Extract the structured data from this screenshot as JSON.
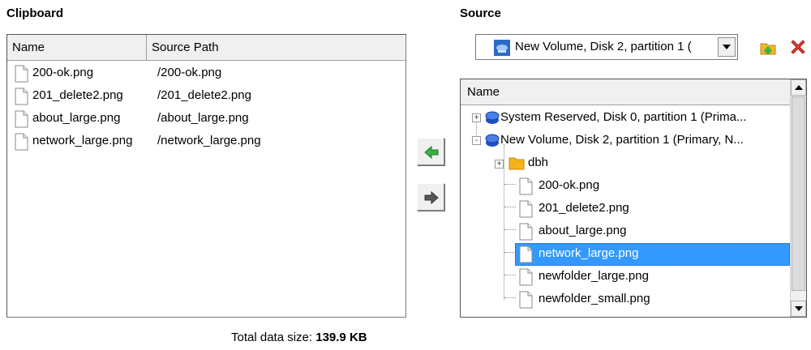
{
  "clipboard": {
    "title": "Clipboard",
    "columns": {
      "name": "Name",
      "source_path": "Source Path"
    },
    "rows": [
      {
        "name": "200-ok.png",
        "path": "/200-ok.png"
      },
      {
        "name": "201_delete2.png",
        "path": "/201_delete2.png"
      },
      {
        "name": "about_large.png",
        "path": "/about_large.png"
      },
      {
        "name": "network_large.png",
        "path": "/network_large.png"
      }
    ]
  },
  "source": {
    "title": "Source",
    "selected_volume": "New Volume, Disk 2, partition 1 (",
    "tree_header": "Name",
    "tree": [
      {
        "label": "System Reserved, Disk 0, partition 1 (Prima...",
        "type": "disk",
        "expander": "+"
      },
      {
        "label": "New Volume, Disk 2, partition 1 (Primary, N...",
        "type": "disk",
        "expander": "-"
      },
      {
        "label": "dbh",
        "type": "folder",
        "expander": "+"
      },
      {
        "label": "200-ok.png",
        "type": "file"
      },
      {
        "label": "201_delete2.png",
        "type": "file"
      },
      {
        "label": "about_large.png",
        "type": "file"
      },
      {
        "label": "network_large.png",
        "type": "file",
        "selected": true
      },
      {
        "label": "newfolder_large.png",
        "type": "file"
      },
      {
        "label": "newfolder_small.png",
        "type": "file"
      }
    ]
  },
  "summary": {
    "total_label": "Total data size:",
    "total_value": "139.9 KB"
  },
  "colors": {
    "selection": "#3399ff",
    "arrow_green": "#3cb043",
    "add_icon": "#e8a317",
    "delete_icon": "#e03a2f"
  }
}
